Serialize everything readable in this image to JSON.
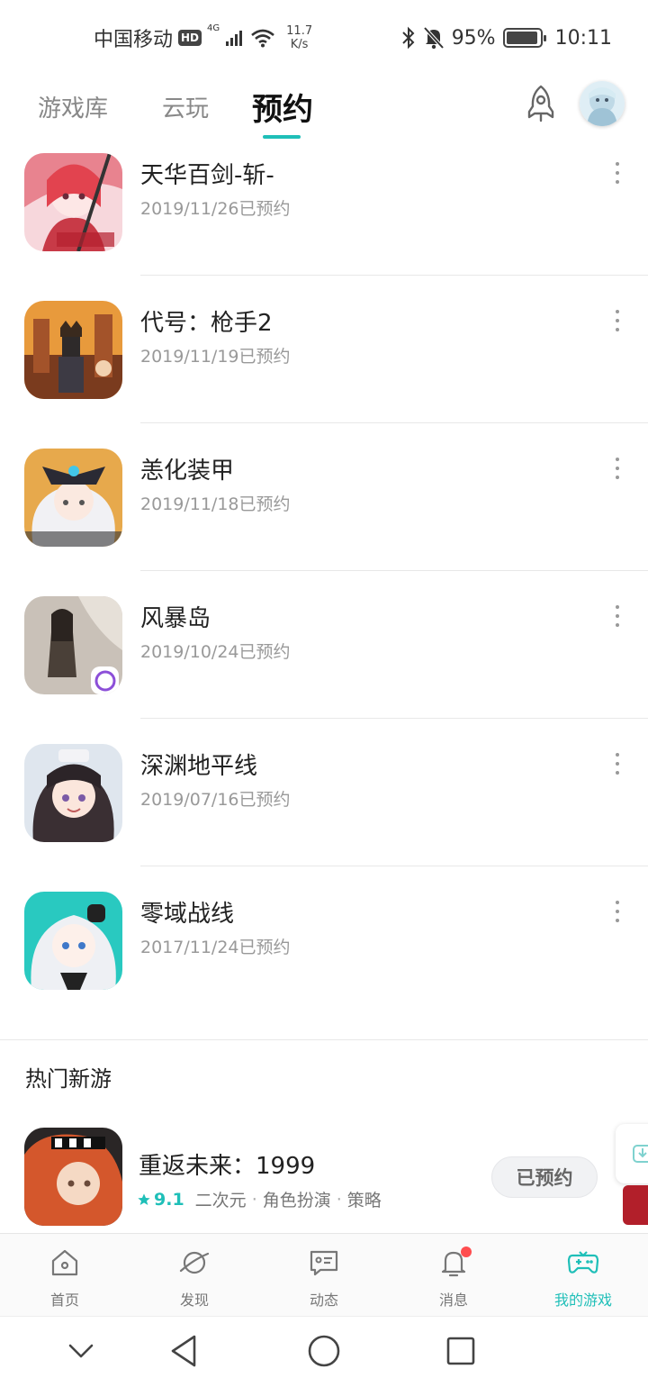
{
  "status_bar": {
    "carrier": "中国移动",
    "hd": "HD",
    "network": "4G",
    "speed_value": "11.7",
    "speed_unit": "K/s",
    "battery": "95%",
    "battery_level": 0.95,
    "time": "10:11"
  },
  "top_tabs": {
    "library": "游戏库",
    "cloud": "云玩",
    "reserve": "预约"
  },
  "reservations": [
    {
      "name": "天华百剑-斩-",
      "date": "2019/11/26已预约",
      "icon": "game-icon-tianhua"
    },
    {
      "name": "代号：枪手2",
      "date": "2019/11/19已预约",
      "icon": "game-icon-gunner2"
    },
    {
      "name": "恙化装甲",
      "date": "2019/11/18已预约",
      "icon": "game-icon-armor"
    },
    {
      "name": "风暴岛",
      "date": "2019/10/24已预约",
      "icon": "game-icon-storm-island"
    },
    {
      "name": "深渊地平线",
      "date": "2019/07/16已预约",
      "icon": "game-icon-abyss-horizon"
    },
    {
      "name": "零域战线",
      "date": "2017/11/24已预约",
      "icon": "game-icon-zero-domain"
    }
  ],
  "hot_section": {
    "title": "热门新游",
    "game": {
      "name": "重返未来：1999",
      "rating": "9.1",
      "tags": [
        "二次元",
        "角色扮演",
        "策略"
      ],
      "separator": "·",
      "button": "已预约"
    }
  },
  "bottom_nav": [
    {
      "label": "首页",
      "icon": "home-icon",
      "active": false
    },
    {
      "label": "发现",
      "icon": "planet-icon",
      "active": false
    },
    {
      "label": "动态",
      "icon": "feed-icon",
      "active": false
    },
    {
      "label": "消息",
      "icon": "bell-icon",
      "active": false
    },
    {
      "label": "我的游戏",
      "icon": "gamepad-icon",
      "active": true
    }
  ],
  "colors": {
    "accent": "#1fbfb8",
    "badge": "#ff4d4f"
  }
}
